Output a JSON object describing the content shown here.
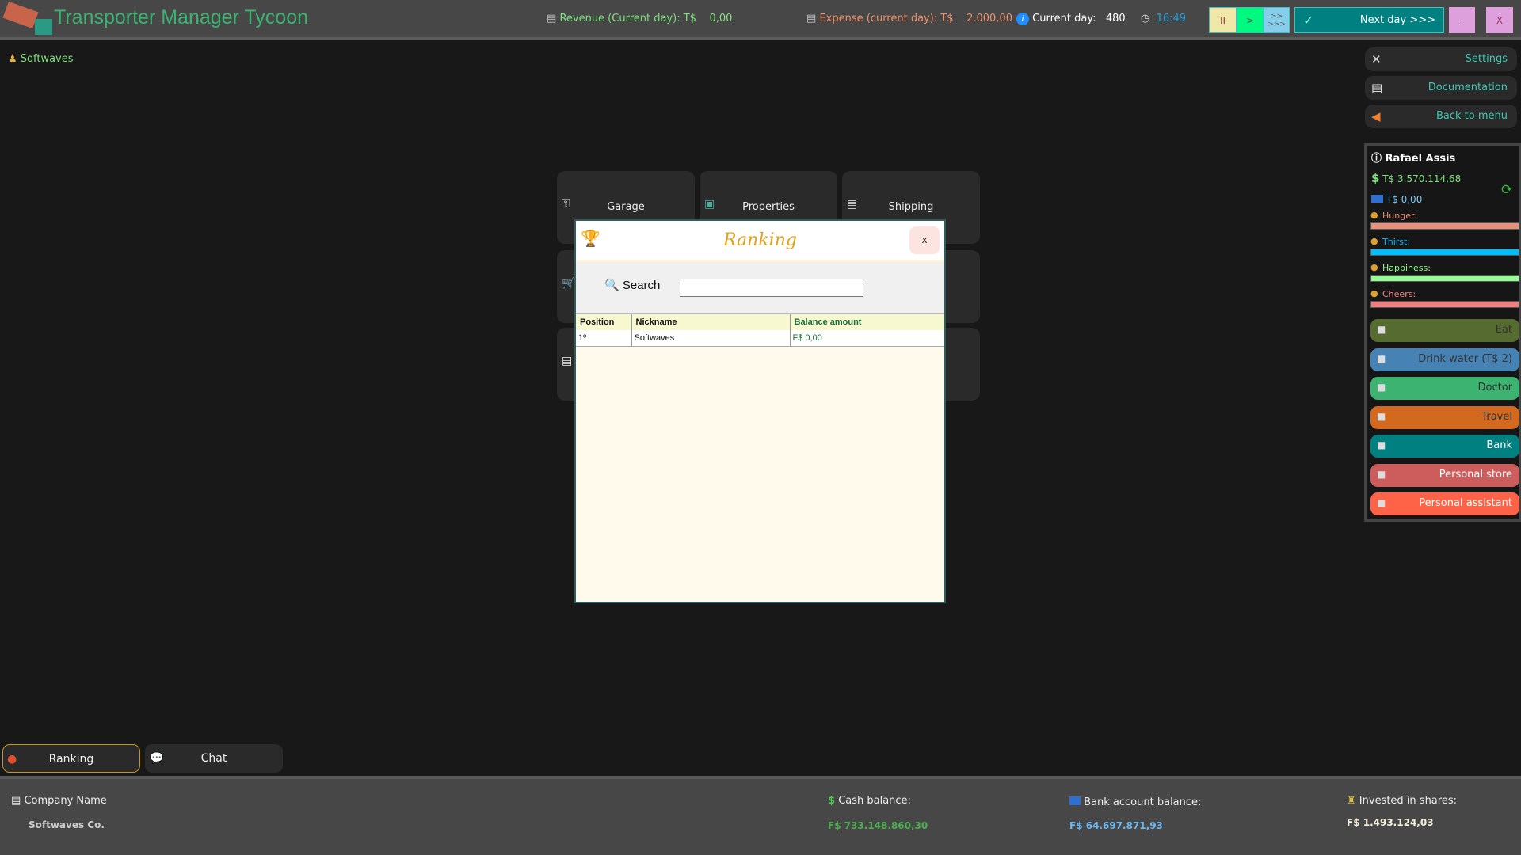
{
  "header": {
    "title": "Transporter Manager Tycoon",
    "revenue_label": "Revenue (Current day): T$",
    "revenue_value": "0,00",
    "expense_label": "Expense (current day): T$",
    "expense_value": "2.000,00",
    "day_label": "Current day:",
    "day_value": "480",
    "time": "16:49",
    "pause": "II",
    "play": ">",
    "fast_top": ">>",
    "fast_bottom": ">>>",
    "next_day": "Next day >>>",
    "minimize": "-",
    "close": "X"
  },
  "company_tag": "Softwaves",
  "side_menu": {
    "settings": "Settings",
    "documentation": "Documentation",
    "back": "Back to menu"
  },
  "player": {
    "name": "Rafael Assis",
    "cash": "T$  3.570.114,68",
    "bank": "T$  0,00",
    "needs": [
      {
        "label": "Hunger:",
        "color": "#e8907a",
        "level": 100
      },
      {
        "label": "Thirst:",
        "color": "#00bfff",
        "level": 100
      },
      {
        "label": "Happiness:",
        "color": "#98fb98",
        "level": 100
      },
      {
        "label": "Cheers:",
        "color": "#f08080",
        "level": 100
      }
    ],
    "actions": [
      {
        "label": "Eat",
        "color": "#556b2f"
      },
      {
        "label": "Drink water (T$ 2)",
        "color": "#4682b4"
      },
      {
        "label": "Doctor",
        "color": "#3cb371"
      },
      {
        "label": "Travel",
        "color": "#d2691e"
      },
      {
        "label": "Bank",
        "color": "#008080"
      },
      {
        "label": "Personal store",
        "color": "#cd5c5c"
      },
      {
        "label": "Personal assistant",
        "color": "#ff6347"
      }
    ]
  },
  "tiles": [
    "Garage",
    "Properties",
    "Shipping"
  ],
  "modal": {
    "title": "Ranking",
    "close": "x",
    "search_label": "Search",
    "search_value": "",
    "columns": [
      "Position",
      "Nickname",
      "Balance amount"
    ],
    "rows": [
      [
        "1º",
        "Softwaves",
        "F$  0,00"
      ]
    ]
  },
  "bottom_tabs": [
    "Ranking",
    "Chat"
  ],
  "footer": {
    "company_label": "Company Name",
    "company_value": "Softwaves Co.",
    "cash_label": "Cash balance:",
    "cash_value": "F$  733.148.860,30",
    "bank_label": "Bank account balance:",
    "bank_value": "F$  64.697.871,93",
    "shares_label": "Invested in shares:",
    "shares_value": "F$  1.493.124,03"
  }
}
